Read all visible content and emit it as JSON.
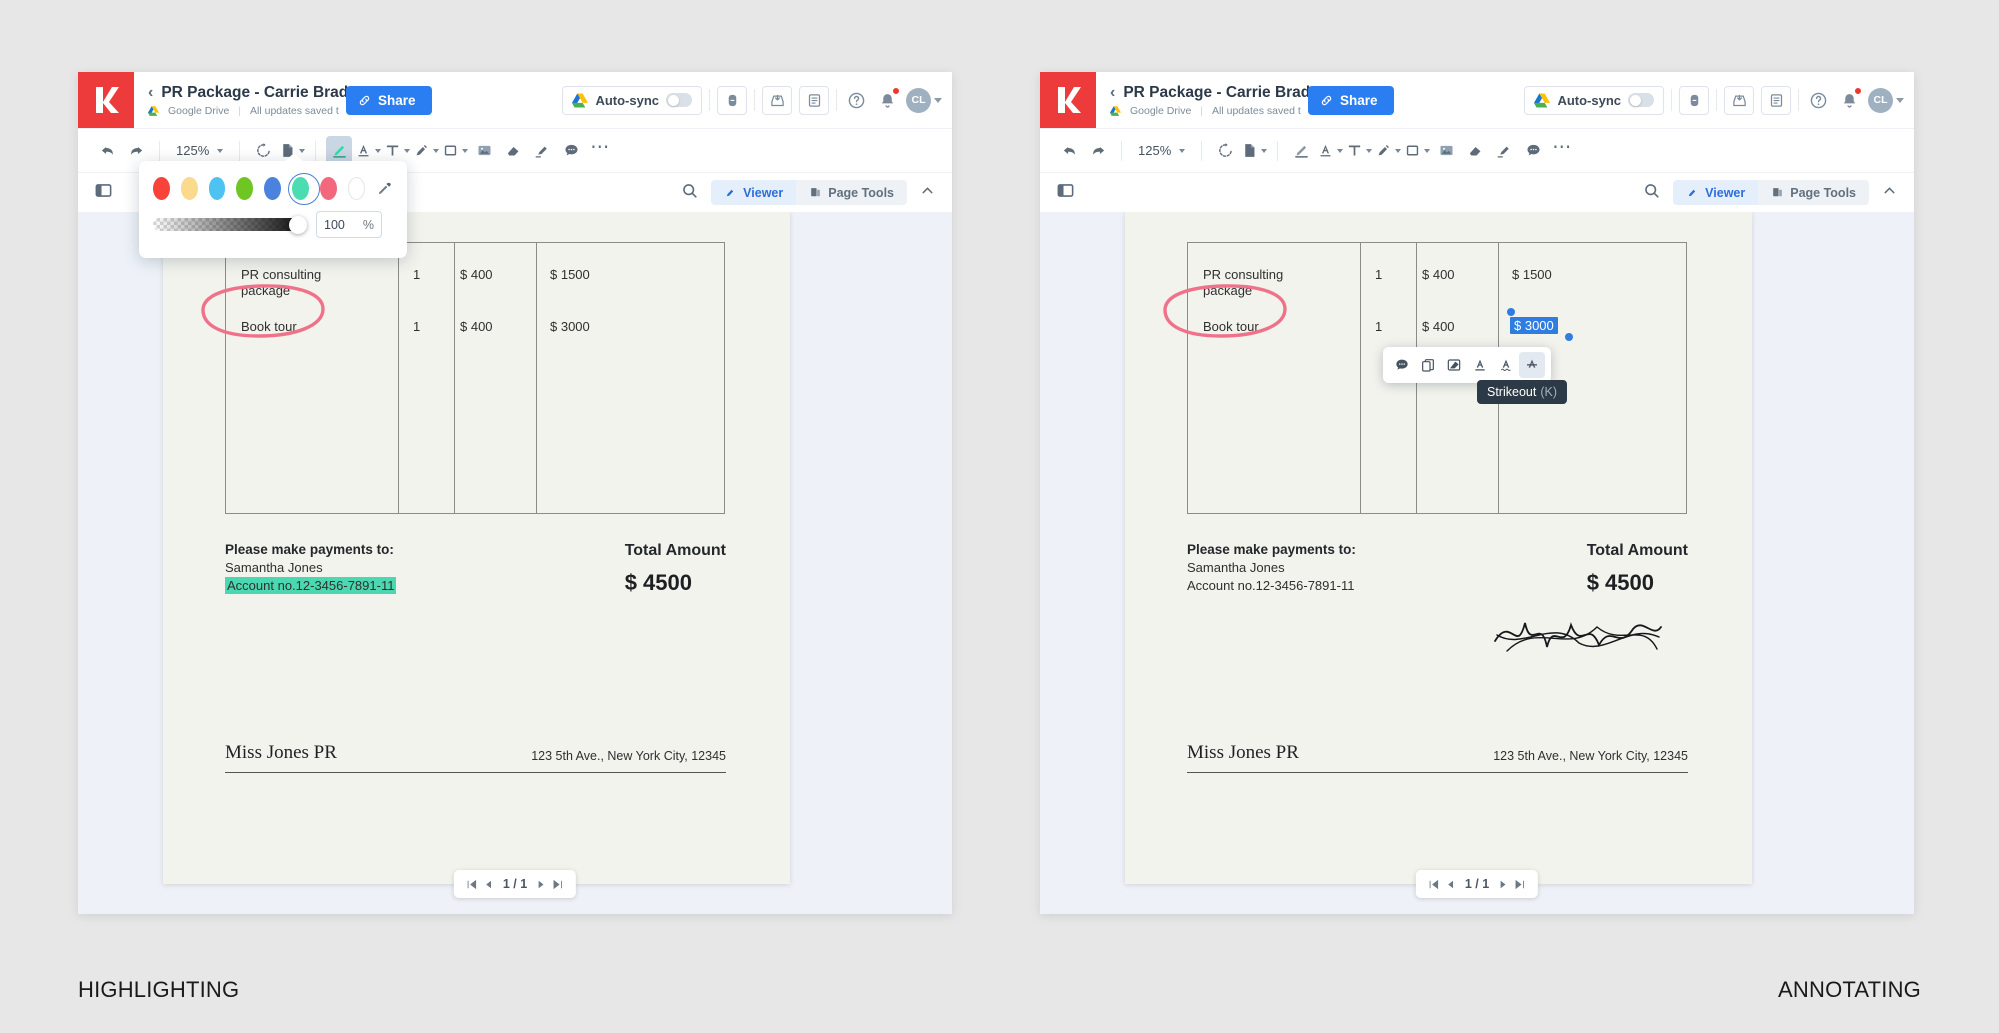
{
  "captions": {
    "left": "HIGHLIGHTING",
    "right": "ANNOTATING"
  },
  "header": {
    "doc_title": "PR Package - Carrie Brad.",
    "storage": "Google Drive",
    "save_status": "All updates saved t",
    "share_label": "Share",
    "autosync_label": "Auto-sync",
    "avatar_initials": "CL"
  },
  "toolbar": {
    "zoom_level": "125%",
    "items": [
      "undo-icon",
      "redo-icon",
      "zoom-select",
      "rotate-icon",
      "page-icon",
      "highlighter-icon",
      "text-color-icon",
      "text-box-icon",
      "pen-icon",
      "shape-icon",
      "image-icon",
      "eraser-icon",
      "signature-icon",
      "comment-icon",
      "more-icon"
    ]
  },
  "viewbar": {
    "sidebar_icon": "panel-icon",
    "search_icon": "search-icon",
    "tab_viewer": "Viewer",
    "tab_page_tools": "Page Tools",
    "collapse_icon": "chevron-up-icon"
  },
  "colors": {
    "accent_blue": "#2a7ef1",
    "logo_red": "#ed3b3b",
    "highlight_green": "#4bd8b0",
    "selection_blue": "#2f7de1",
    "annotation_pink": "#ef7289"
  },
  "color_popup": {
    "swatches": [
      {
        "name": "red",
        "hex": "#f8423a",
        "selected": false
      },
      {
        "name": "yellow",
        "hex": "#fbd98d",
        "selected": false
      },
      {
        "name": "sky",
        "hex": "#4cc3f0",
        "selected": false
      },
      {
        "name": "green",
        "hex": "#6fc522",
        "selected": false
      },
      {
        "name": "blue",
        "hex": "#4a82dd",
        "selected": false
      },
      {
        "name": "mint",
        "hex": "#4bdcb1",
        "selected": true
      },
      {
        "name": "pink",
        "hex": "#f2697e",
        "selected": false
      },
      {
        "name": "white",
        "hex": "#ffffff",
        "selected": false
      }
    ],
    "eyedropper_icon": "eyedropper-icon",
    "opacity_value": "100",
    "opacity_unit": "%"
  },
  "document": {
    "rows": [
      {
        "desc": "PR consulting package",
        "qty": "1",
        "rate": "$ 400",
        "amount": "$ 1500"
      },
      {
        "desc": "Book tour",
        "qty": "1",
        "rate": "$ 400",
        "amount": "$ 3000"
      }
    ],
    "pay_heading": "Please make payments to:",
    "pay_name": "Samantha Jones",
    "pay_account": "Account no.12-3456-7891-11",
    "total_label": "Total Amount",
    "total_value": "$ 4500",
    "brand": "Miss Jones PR",
    "address": "123 5th Ave., New York City, 12345"
  },
  "pager": {
    "current": "1 / 1"
  },
  "float_toolbar": {
    "items": [
      {
        "name": "comment-icon",
        "active": false
      },
      {
        "name": "copy-icon",
        "active": false
      },
      {
        "name": "highlight-icon",
        "active": false
      },
      {
        "name": "underline-icon",
        "active": false
      },
      {
        "name": "squiggly-icon",
        "active": false
      },
      {
        "name": "strikeout-icon",
        "active": true
      }
    ],
    "tooltip_label": "Strikeout",
    "tooltip_shortcut": "(K)"
  }
}
